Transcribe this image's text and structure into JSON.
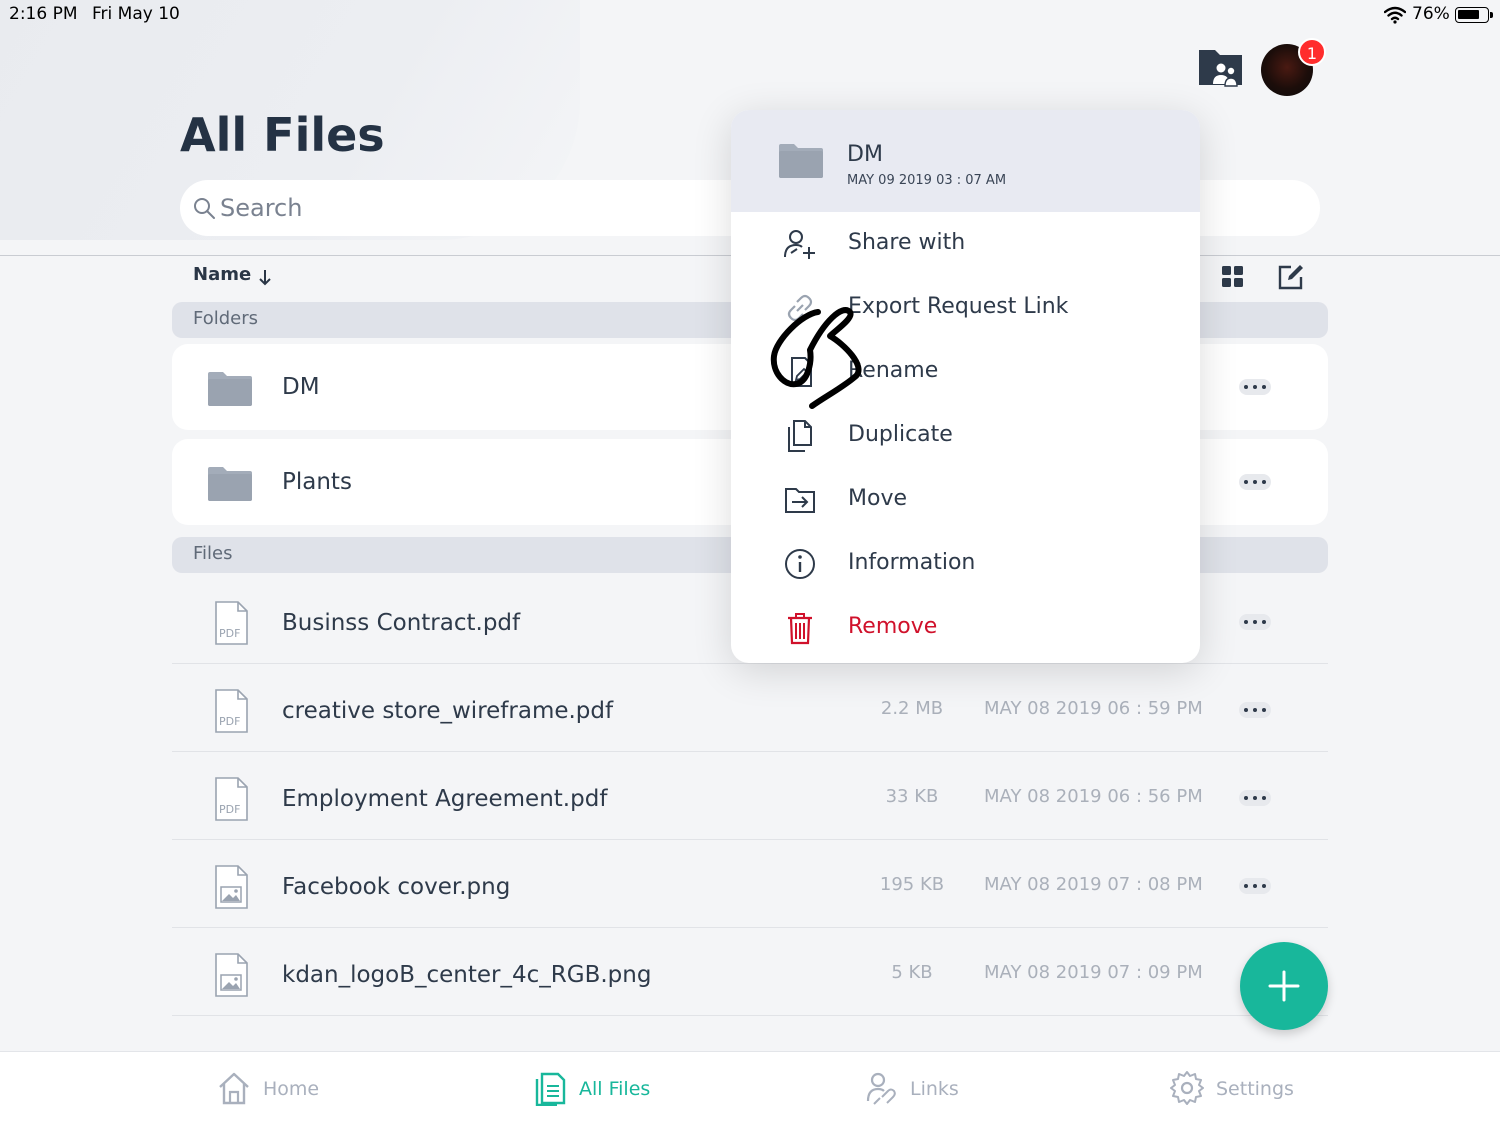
{
  "status_bar": {
    "time": "2:16 PM",
    "date": "Fri May 10",
    "battery": "76%"
  },
  "header": {
    "title": "All Files",
    "notification_count": "1",
    "search": {
      "placeholder": "Search",
      "value": ""
    }
  },
  "toolbar": {
    "sort_label": "Name"
  },
  "sections": {
    "folders": "Folders",
    "files": "Files"
  },
  "folders": [
    {
      "name": "DM"
    },
    {
      "name": "Plants"
    }
  ],
  "files": [
    {
      "name": "Businss Contract.pdf",
      "type": "pdf",
      "size": "",
      "date": ""
    },
    {
      "name": "creative store_wireframe.pdf",
      "type": "pdf",
      "size": "2.2 MB",
      "date": "MAY 08 2019 06 : 59 PM"
    },
    {
      "name": "Employment Agreement.pdf",
      "type": "pdf",
      "size": "33 KB",
      "date": "MAY 08 2019 06 : 56 PM"
    },
    {
      "name": "Facebook cover.png",
      "type": "image",
      "size": "195 KB",
      "date": "MAY 08 2019 07 : 08 PM"
    },
    {
      "name": "kdan_logoB_center_4c_RGB.png",
      "type": "image",
      "size": "5 KB",
      "date": "MAY 08 2019 07 : 09 PM"
    }
  ],
  "context_menu": {
    "header": {
      "title": "DM",
      "subtitle": "MAY 09 2019 03 : 07 AM"
    },
    "items": [
      {
        "label": "Share with",
        "icon": "share-user-icon"
      },
      {
        "label": "Export Request Link",
        "icon": "link-icon"
      },
      {
        "label": "Rename",
        "icon": "rename-icon"
      },
      {
        "label": "Duplicate",
        "icon": "duplicate-icon"
      },
      {
        "label": "Move",
        "icon": "move-icon"
      },
      {
        "label": "Information",
        "icon": "info-icon"
      },
      {
        "label": "Remove",
        "icon": "trash-icon",
        "danger": true
      }
    ]
  },
  "tab_bar": {
    "items": [
      {
        "label": "Home",
        "icon": "home-icon"
      },
      {
        "label": "All Files",
        "icon": "files-icon",
        "active": true
      },
      {
        "label": "Links",
        "icon": "links-icon"
      },
      {
        "label": "Settings",
        "icon": "gear-icon"
      }
    ]
  },
  "colors": {
    "accent": "#18b79b",
    "danger": "#d0112b",
    "badge": "#ff2d2d",
    "menu_header": "#e8eaf2",
    "section_bg": "#dfe2e9"
  }
}
